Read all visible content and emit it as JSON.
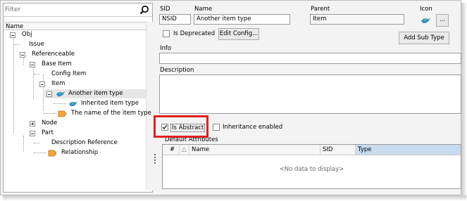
{
  "filter": {
    "placeholder": "Filter"
  },
  "tree": {
    "column_header": "Name",
    "nodes": [
      "Obj",
      "Issue",
      "Referenceable",
      "Base Item",
      "Config Item",
      "Item",
      "Another item type",
      "Inherited item type",
      "The name of the item type",
      "Node",
      "Part",
      "Description Reference",
      "Relationship"
    ]
  },
  "form": {
    "sid_label": "SID",
    "sid_value": "NSID",
    "name_label": "Name",
    "name_value": "Another item type",
    "parent_label": "Parent",
    "parent_value": "Item",
    "icon_label": "Icon",
    "icon_button": "...",
    "is_deprecated": "Is Deprecated",
    "edit_config": "Edit Config...",
    "add_sub_type": "Add Sub Type",
    "info_label": "Info",
    "description_label": "Description",
    "is_abstract": "Is Abstract",
    "inheritance_enabled": "Inheritance enabled",
    "default_attributes": "Default Attributes"
  },
  "grid": {
    "columns": [
      "#",
      "Name",
      "SID",
      "Type"
    ],
    "empty_text": "<No data to display>"
  },
  "colors": {
    "highlight": "#e02020",
    "selection": "#e6e6e6"
  }
}
